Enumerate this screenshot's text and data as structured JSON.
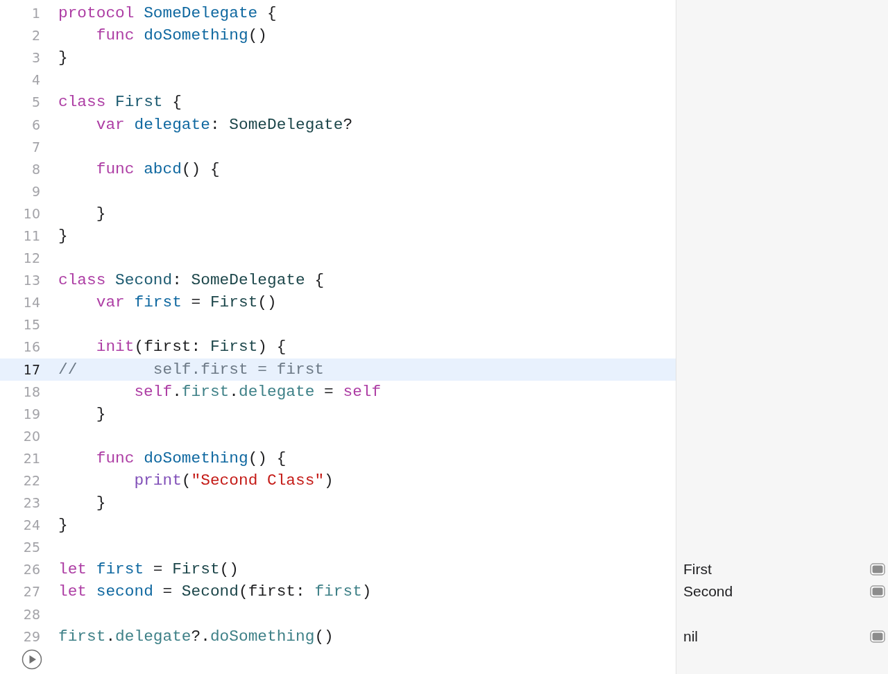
{
  "editor": {
    "lines": [
      {
        "number": "1",
        "highlighted": false,
        "tokens": [
          {
            "text": "protocol",
            "kind": "keyword"
          },
          {
            "text": " SomeDelegate",
            "kind": "decl"
          },
          {
            "text": " {",
            "kind": "plain"
          }
        ]
      },
      {
        "number": "2",
        "highlighted": false,
        "tokens": [
          {
            "text": "    func",
            "kind": "keyword"
          },
          {
            "text": " doSomething",
            "kind": "decl"
          },
          {
            "text": "()",
            "kind": "plain"
          }
        ]
      },
      {
        "number": "3",
        "highlighted": false,
        "tokens": [
          {
            "text": "}",
            "kind": "plain"
          }
        ]
      },
      {
        "number": "4",
        "highlighted": false
      },
      {
        "number": "5",
        "highlighted": false,
        "tokens": [
          {
            "text": "class",
            "kind": "keyword"
          },
          {
            "text": " First",
            "kind": "typedecl"
          },
          {
            "text": " {",
            "kind": "plain"
          }
        ]
      },
      {
        "number": "6",
        "highlighted": false,
        "tokens": [
          {
            "text": "    var",
            "kind": "keyword"
          },
          {
            "text": " delegate",
            "kind": "decl"
          },
          {
            "text": ": ",
            "kind": "plain"
          },
          {
            "text": "SomeDelegate",
            "kind": "type"
          },
          {
            "text": "?",
            "kind": "plain"
          }
        ]
      },
      {
        "number": "7",
        "highlighted": false
      },
      {
        "number": "8",
        "highlighted": false,
        "tokens": [
          {
            "text": "    func",
            "kind": "keyword"
          },
          {
            "text": " abcd",
            "kind": "decl"
          },
          {
            "text": "() {",
            "kind": "plain"
          }
        ]
      },
      {
        "number": "9",
        "highlighted": false
      },
      {
        "number": "10",
        "highlighted": false,
        "tokens": [
          {
            "text": "    }",
            "kind": "plain"
          }
        ]
      },
      {
        "number": "11",
        "highlighted": false,
        "tokens": [
          {
            "text": "}",
            "kind": "plain"
          }
        ]
      },
      {
        "number": "12",
        "highlighted": false
      },
      {
        "number": "13",
        "highlighted": false,
        "tokens": [
          {
            "text": "class",
            "kind": "keyword"
          },
          {
            "text": " Second",
            "kind": "typedecl"
          },
          {
            "text": ": ",
            "kind": "plain"
          },
          {
            "text": "SomeDelegate",
            "kind": "type"
          },
          {
            "text": " {",
            "kind": "plain"
          }
        ]
      },
      {
        "number": "14",
        "highlighted": false,
        "tokens": [
          {
            "text": "    var",
            "kind": "keyword"
          },
          {
            "text": " first",
            "kind": "decl"
          },
          {
            "text": " = ",
            "kind": "plain"
          },
          {
            "text": "First",
            "kind": "type"
          },
          {
            "text": "()",
            "kind": "plain"
          }
        ]
      },
      {
        "number": "15",
        "highlighted": false
      },
      {
        "number": "16",
        "highlighted": false,
        "tokens": [
          {
            "text": "    init",
            "kind": "keyword"
          },
          {
            "text": "(first: ",
            "kind": "plain"
          },
          {
            "text": "First",
            "kind": "type"
          },
          {
            "text": ") {",
            "kind": "plain"
          }
        ]
      },
      {
        "number": "17",
        "highlighted": true,
        "tokens": [
          {
            "text": "//        self.first = first",
            "kind": "comment"
          }
        ]
      },
      {
        "number": "18",
        "highlighted": false,
        "tokens": [
          {
            "text": "        self",
            "kind": "keyword"
          },
          {
            "text": ".",
            "kind": "plain"
          },
          {
            "text": "first",
            "kind": "member"
          },
          {
            "text": ".",
            "kind": "plain"
          },
          {
            "text": "delegate",
            "kind": "member"
          },
          {
            "text": " = ",
            "kind": "plain"
          },
          {
            "text": "self",
            "kind": "keyword"
          }
        ]
      },
      {
        "number": "19",
        "highlighted": false,
        "tokens": [
          {
            "text": "    }",
            "kind": "plain"
          }
        ]
      },
      {
        "number": "20",
        "highlighted": false
      },
      {
        "number": "21",
        "highlighted": false,
        "tokens": [
          {
            "text": "    func",
            "kind": "keyword"
          },
          {
            "text": " doSomething",
            "kind": "decl"
          },
          {
            "text": "() {",
            "kind": "plain"
          }
        ]
      },
      {
        "number": "22",
        "highlighted": false,
        "tokens": [
          {
            "text": "        print",
            "kind": "builtin"
          },
          {
            "text": "(",
            "kind": "plain"
          },
          {
            "text": "\"Second Class\"",
            "kind": "string"
          },
          {
            "text": ")",
            "kind": "plain"
          }
        ]
      },
      {
        "number": "23",
        "highlighted": false,
        "tokens": [
          {
            "text": "    }",
            "kind": "plain"
          }
        ]
      },
      {
        "number": "24",
        "highlighted": false,
        "tokens": [
          {
            "text": "}",
            "kind": "plain"
          }
        ]
      },
      {
        "number": "25",
        "highlighted": false
      },
      {
        "number": "26",
        "highlighted": false,
        "result": "First",
        "tokens": [
          {
            "text": "let",
            "kind": "keyword"
          },
          {
            "text": " first",
            "kind": "decl"
          },
          {
            "text": " = ",
            "kind": "plain"
          },
          {
            "text": "First",
            "kind": "type"
          },
          {
            "text": "()",
            "kind": "plain"
          }
        ]
      },
      {
        "number": "27",
        "highlighted": false,
        "result": "Second",
        "tokens": [
          {
            "text": "let",
            "kind": "keyword"
          },
          {
            "text": " second",
            "kind": "decl"
          },
          {
            "text": " = ",
            "kind": "plain"
          },
          {
            "text": "Second",
            "kind": "type"
          },
          {
            "text": "(first: ",
            "kind": "plain"
          },
          {
            "text": "first",
            "kind": "member"
          },
          {
            "text": ")",
            "kind": "plain"
          }
        ]
      },
      {
        "number": "28",
        "highlighted": false
      },
      {
        "number": "29",
        "highlighted": false,
        "result": "nil",
        "tokens": [
          {
            "text": "first",
            "kind": "member"
          },
          {
            "text": ".",
            "kind": "plain"
          },
          {
            "text": "delegate",
            "kind": "member"
          },
          {
            "text": "?.",
            "kind": "plain"
          },
          {
            "text": "doSomething",
            "kind": "member"
          },
          {
            "text": "()",
            "kind": "plain"
          }
        ]
      }
    ]
  }
}
